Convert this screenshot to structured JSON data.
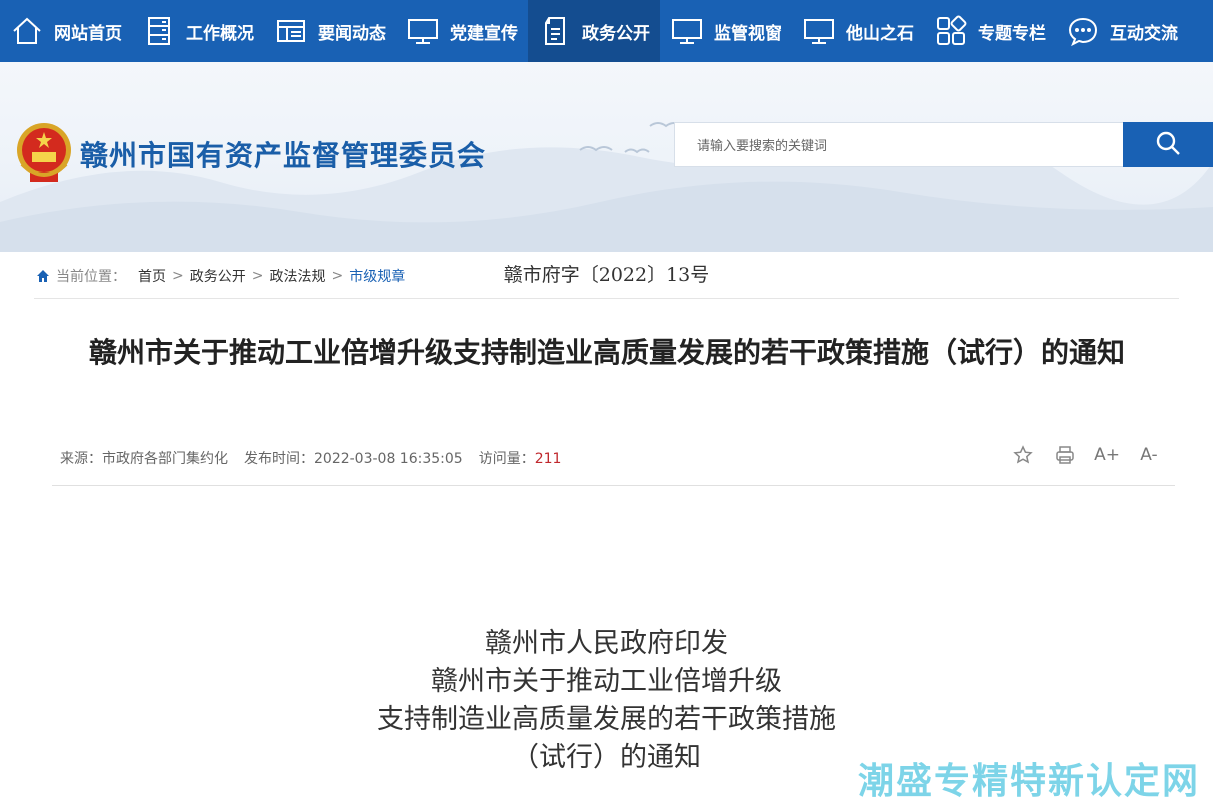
{
  "nav": {
    "items": [
      {
        "label": "网站首页",
        "icon": "home-icon"
      },
      {
        "label": "工作概况",
        "icon": "cabinet-icon"
      },
      {
        "label": "要闻动态",
        "icon": "news-icon"
      },
      {
        "label": "党建宣传",
        "icon": "monitor-icon"
      },
      {
        "label": "政务公开",
        "icon": "document-icon",
        "active": true
      },
      {
        "label": "监管视窗",
        "icon": "monitor-icon"
      },
      {
        "label": "他山之石",
        "icon": "monitor-icon"
      },
      {
        "label": "专题专栏",
        "icon": "grid-icon"
      },
      {
        "label": "互动交流",
        "icon": "chat-icon"
      }
    ]
  },
  "header": {
    "site_title": "赣州市国有资产监督管理委员会",
    "search_placeholder": "请输入要搜索的关键词"
  },
  "breadcrumb": {
    "label": "当前位置：",
    "items": [
      "首页",
      "政务公开",
      "政法法规",
      "市级规章"
    ]
  },
  "article": {
    "title": "赣州市关于推动工业倍增升级支持制造业高质量发展的若干政策措施（试行）的通知",
    "source_label": "来源：",
    "source": "市政府各部门集约化",
    "date_label": "发布时间：",
    "date": "2022-03-08 16:35:05",
    "views_label": "访问量：",
    "views": "211",
    "doc_number": "赣市府字〔2022〕13号",
    "heading_lines": [
      "赣州市人民政府印发",
      "赣州市关于推动工业倍增升级",
      "支持制造业高质量发展的若干政策措施",
      "（试行）的通知"
    ]
  },
  "tools": [
    "star-icon",
    "print-icon",
    "font-increase-icon",
    "font-decrease-icon"
  ],
  "tool_labels": {
    "increase": "A+",
    "decrease": "A-"
  },
  "watermark": "潮盛专精特新认定网",
  "colors": {
    "primary": "#1961b4",
    "active_nav": "#144d90",
    "views": "#c0282d",
    "watermark": "#6fd0e6"
  }
}
